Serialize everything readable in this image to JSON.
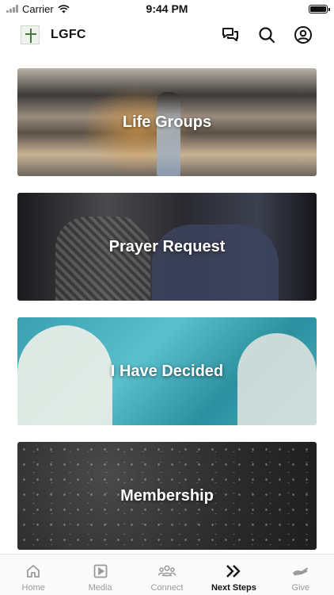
{
  "status_bar": {
    "carrier": "Carrier",
    "time": "9:44 PM",
    "battery_level": 1.0
  },
  "header": {
    "title": "LGFC",
    "icons": [
      "chat-icon",
      "search-icon",
      "profile-icon"
    ]
  },
  "cards": [
    {
      "label": "Life Groups"
    },
    {
      "label": "Prayer Request"
    },
    {
      "label": "I Have Decided"
    },
    {
      "label": "Membership"
    }
  ],
  "tabs": [
    {
      "label": "Home",
      "icon": "home-icon",
      "active": false
    },
    {
      "label": "Media",
      "icon": "media-icon",
      "active": false
    },
    {
      "label": "Connect",
      "icon": "connect-icon",
      "active": false
    },
    {
      "label": "Next Steps",
      "icon": "next-steps-icon",
      "active": true
    },
    {
      "label": "Give",
      "icon": "give-icon",
      "active": false
    }
  ],
  "colors": {
    "active_tab": "#111111",
    "inactive_tab": "#9a9a9a",
    "background": "#ffffff"
  }
}
